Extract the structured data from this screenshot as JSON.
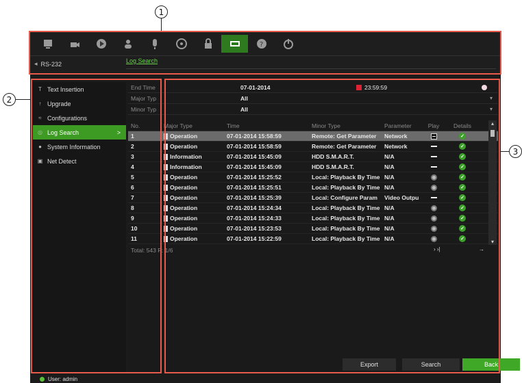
{
  "callouts": {
    "one": "1",
    "two": "2",
    "three": "3"
  },
  "toolbar": {
    "icons": [
      "monitor-icon",
      "camera-icon",
      "playback-icon",
      "users-icon",
      "alarm-icon",
      "network-icon",
      "lock-icon",
      "device-icon",
      "help-icon",
      "power-icon"
    ],
    "active_index": 7
  },
  "subbar": {
    "rs232": "RS-232",
    "tab": "Log Search"
  },
  "sidebar": {
    "items": [
      {
        "label": "Text Insertion",
        "icon": "text-icon"
      },
      {
        "label": "Upgrade",
        "icon": "upgrade-icon"
      },
      {
        "label": "Configurations",
        "icon": "config-icon"
      },
      {
        "label": "Log Search",
        "icon": "search-icon"
      },
      {
        "label": "System Information",
        "icon": "info-icon"
      },
      {
        "label": "Net Detect",
        "icon": "net-icon"
      }
    ],
    "active_chevron": ">"
  },
  "filters": {
    "end_time_label": "End Time",
    "end_date": "07-01-2014",
    "end_clock": "23:59:59",
    "major_label": "Major Typ",
    "major_value": "All",
    "minor_label": "Minor Typ",
    "minor_value": "All"
  },
  "table": {
    "headers": {
      "no": "No.",
      "type": "Major Type",
      "time": "Time",
      "minor": "Minor Type",
      "param": "Parameter",
      "play": "Play",
      "details": "Details"
    },
    "rows": [
      {
        "no": "1",
        "type": "Operation",
        "time": "07-01-2014 15:58:59",
        "minor": "Remote: Get Parameter",
        "param": "Network",
        "play": "dash-box"
      },
      {
        "no": "2",
        "type": "Operation",
        "time": "07-01-2014 15:58:59",
        "minor": "Remote: Get Parameter",
        "param": "Network",
        "play": "dash"
      },
      {
        "no": "3",
        "type": "Information",
        "time": "07-01-2014 15:45:09",
        "minor": "HDD S.M.A.R.T.",
        "param": "N/A",
        "play": "dash"
      },
      {
        "no": "4",
        "type": "Information",
        "time": "07-01-2014 15:45:09",
        "minor": "HDD S.M.A.R.T.",
        "param": "N/A",
        "play": "dash"
      },
      {
        "no": "5",
        "type": "Operation",
        "time": "07-01-2014 15:25:52",
        "minor": "Local: Playback By Time",
        "param": "N/A",
        "play": "circle"
      },
      {
        "no": "6",
        "type": "Operation",
        "time": "07-01-2014 15:25:51",
        "minor": "Local: Playback By Time",
        "param": "N/A",
        "play": "circle"
      },
      {
        "no": "7",
        "type": "Operation",
        "time": "07-01-2014 15:25:39",
        "minor": "Local: Configure Param",
        "param": "Video Output",
        "play": "dash"
      },
      {
        "no": "8",
        "type": "Operation",
        "time": "07-01-2014 15:24:34",
        "minor": "Local: Playback By Time",
        "param": "N/A",
        "play": "circle"
      },
      {
        "no": "9",
        "type": "Operation",
        "time": "07-01-2014 15:24:33",
        "minor": "Local: Playback By Time",
        "param": "N/A",
        "play": "circle"
      },
      {
        "no": "10",
        "type": "Operation",
        "time": "07-01-2014 15:23:53",
        "minor": "Local: Playback By Time",
        "param": "N/A",
        "play": "circle"
      },
      {
        "no": "11",
        "type": "Operation",
        "time": "07-01-2014 15:22:59",
        "minor": "Local: Playback By Time",
        "param": "N/A",
        "play": "circle"
      }
    ],
    "selected_row": 0,
    "total": "Total: 543  P: 1/6",
    "pager": "› ›|",
    "goto": "→"
  },
  "buttons": {
    "export": "Export",
    "search": "Search",
    "back": "Back"
  },
  "status": {
    "user": "User: admin"
  },
  "colors": {
    "accent_green": "#3fa827",
    "callout_red": "#e85a4a",
    "bg": "#1b1b1b"
  }
}
